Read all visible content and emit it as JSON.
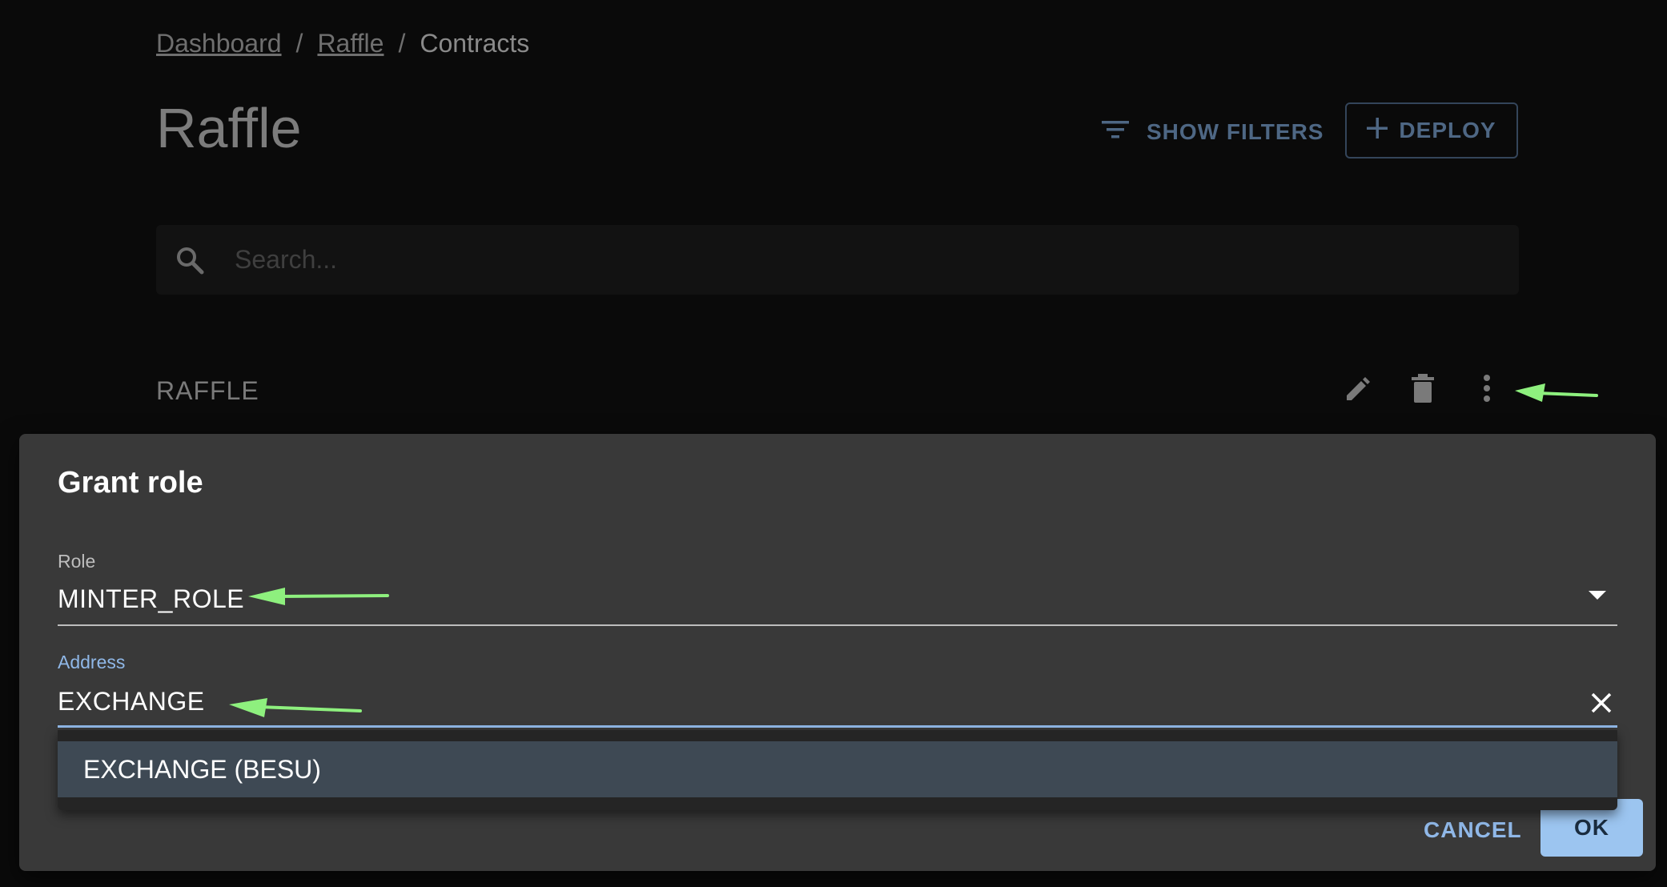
{
  "breadcrumb": {
    "items": [
      {
        "label": "Dashboard"
      },
      {
        "label": "Raffle"
      },
      {
        "label": "Contracts"
      }
    ],
    "separator": "/"
  },
  "page": {
    "title": "Raffle",
    "show_filters_label": "SHOW FILTERS",
    "deploy_label": "DEPLOY"
  },
  "search": {
    "placeholder": "Search...",
    "value": ""
  },
  "list": {
    "row_title": "RAFFLE"
  },
  "dialog": {
    "title": "Grant role",
    "role": {
      "label": "Role",
      "value": "MINTER_ROLE"
    },
    "address": {
      "label": "Address",
      "value": "EXCHANGE"
    },
    "suggestions": [
      {
        "label": "EXCHANGE (BESU)"
      }
    ],
    "cancel_label": "CANCEL",
    "ok_label": "OK"
  },
  "colors": {
    "accent": "#90b8e8",
    "ok_button": "#9cc5f0",
    "dialog_bg": "#393939",
    "annotation_arrow": "#8ef07e"
  },
  "icons": {
    "filter": "filter-icon",
    "add": "plus-icon",
    "search": "search-icon",
    "edit": "pencil-icon",
    "delete": "trash-icon",
    "more": "more-vert-icon",
    "dropdown": "chevron-down-icon",
    "clear": "close-icon"
  }
}
